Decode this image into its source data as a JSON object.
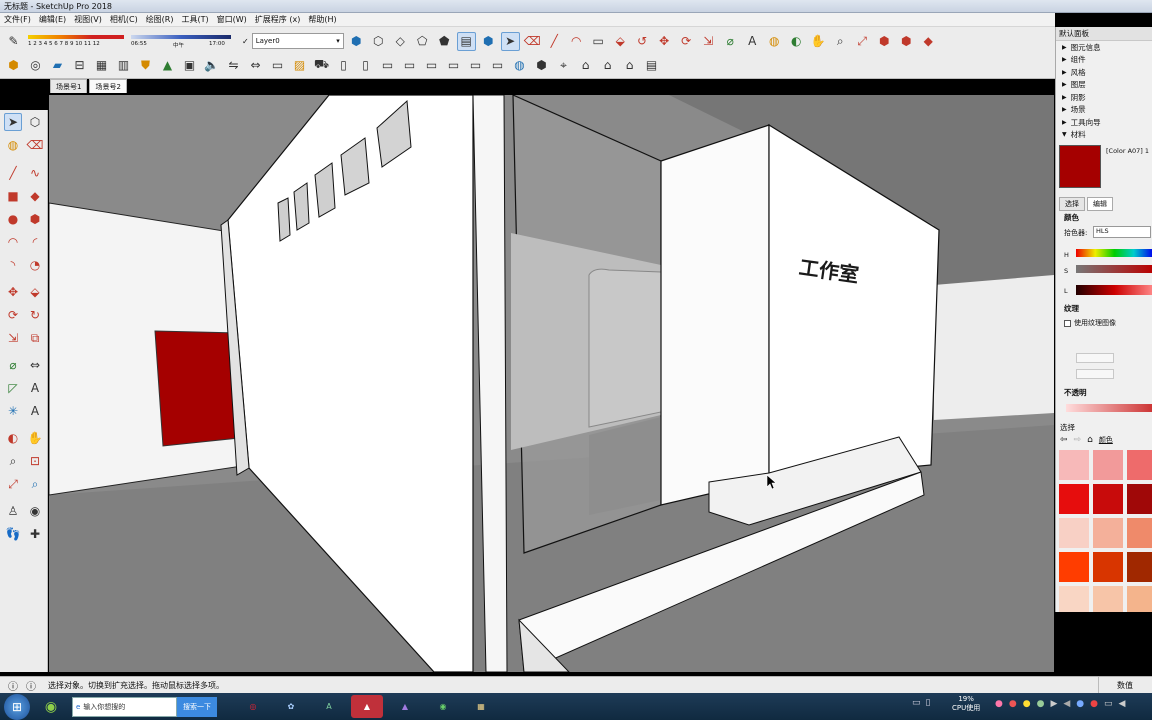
{
  "window": {
    "title": "无标题 - SketchUp Pro 2018"
  },
  "menu": [
    "文件(F)",
    "编辑(E)",
    "视图(V)",
    "相机(C)",
    "绘图(R)",
    "工具(T)",
    "窗口(W)",
    "扩展程序 (x)",
    "帮助(H)"
  ],
  "toolbar": {
    "layer_label": "Layer0",
    "layer_check": "✓",
    "shadow_ticks": "1 2 3 4 5 6 7 8 9 10 11 12",
    "time_start": "06:55",
    "time_mid": "中午",
    "time_end": "17:00"
  },
  "scene_tabs": [
    {
      "label": "场景号1",
      "active": false
    },
    {
      "label": "场景号2",
      "active": true
    }
  ],
  "scene": {
    "sign_text": "工作室",
    "red_color": "#a50000"
  },
  "right_panel": {
    "title": "默认面板",
    "items": [
      "图元信息",
      "组件",
      "风格",
      "图层",
      "阴影",
      "场景",
      "工具向导",
      "材料"
    ],
    "material_name": "[Color A07] 1",
    "tabs": [
      "选择",
      "编辑"
    ],
    "color_label": "颜色",
    "picker_label": "拾色器:",
    "picker_value": "HLS",
    "slider_labels": [
      "H",
      "S",
      "L"
    ],
    "texture_label": "纹理",
    "use_texture_label": "使用纹理图像",
    "opacity_label": "不透明",
    "select_label": "选择",
    "select_dropdown": "颜色",
    "swatches": [
      "#f7b9b9",
      "#f29a9a",
      "#ee6b6b",
      "#e60d0d",
      "#c80b0b",
      "#a00808",
      "#f8d0c5",
      "#f4b09a",
      "#ef8a6a",
      "#ff3d00",
      "#d83500",
      "#a02800",
      "#f9d6c4",
      "#f7c5a8",
      "#f4b48c"
    ]
  },
  "status": {
    "text": "选择对象。切换到扩充选择。拖动鼠标选择多项。",
    "measure_label": "数值"
  },
  "taskbar": {
    "search_placeholder": "输入你想搜的",
    "search_button": "搜索一下",
    "cpu_percent": "19%",
    "cpu_label": "CPU使用"
  }
}
